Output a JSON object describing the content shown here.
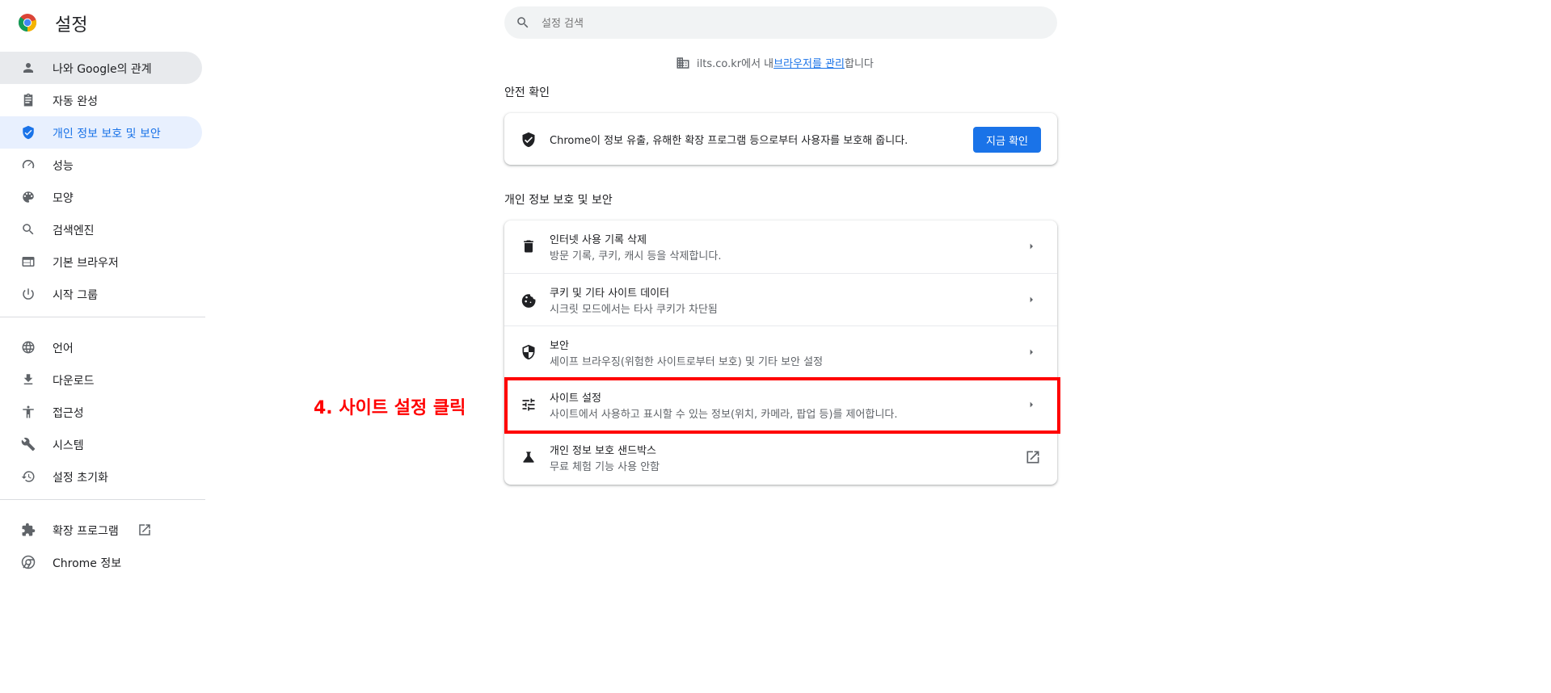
{
  "app": {
    "title": "설정"
  },
  "search": {
    "placeholder": "설정 검색"
  },
  "managed": {
    "prefix": "ilts.co.kr에서 내 ",
    "link": "브라우저를 관리",
    "suffix": "합니다"
  },
  "sidebar": {
    "items": [
      {
        "label": "나와 Google의 관계",
        "icon": "person-icon",
        "state": "hover"
      },
      {
        "label": "자동 완성",
        "icon": "clipboard-icon"
      },
      {
        "label": "개인 정보 보호 및 보안",
        "icon": "shield-icon",
        "state": "active"
      },
      {
        "label": "성능",
        "icon": "speedometer-icon"
      },
      {
        "label": "모양",
        "icon": "palette-icon"
      },
      {
        "label": "검색엔진",
        "icon": "search-icon"
      },
      {
        "label": "기본 브라우저",
        "icon": "browser-icon"
      },
      {
        "label": "시작 그룹",
        "icon": "power-icon"
      }
    ],
    "items2": [
      {
        "label": "언어",
        "icon": "globe-icon"
      },
      {
        "label": "다운로드",
        "icon": "download-icon"
      },
      {
        "label": "접근성",
        "icon": "accessibility-icon"
      },
      {
        "label": "시스템",
        "icon": "wrench-icon"
      },
      {
        "label": "설정 초기화",
        "icon": "history-icon"
      }
    ],
    "items3": [
      {
        "label": "확장 프로그램",
        "icon": "puzzle-icon"
      },
      {
        "label": "Chrome 정보",
        "icon": "chrome-icon"
      }
    ]
  },
  "safety": {
    "section_title": "안전 확인",
    "text": "Chrome이 정보 유출, 유해한 확장 프로그램 등으로부터 사용자를 보호해 줍니다.",
    "button": "지금 확인"
  },
  "privacy": {
    "section_title": "개인 정보 보호 및 보안",
    "rows": [
      {
        "title": "인터넷 사용 기록 삭제",
        "subtitle": "방문 기록, 쿠키, 캐시 등을 삭제합니다.",
        "icon": "trash-icon"
      },
      {
        "title": "쿠키 및 기타 사이트 데이터",
        "subtitle": "시크릿 모드에서는 타사 쿠키가 차단됨",
        "icon": "cookie-icon"
      },
      {
        "title": "보안",
        "subtitle": "세이프 브라우징(위험한 사이트로부터 보호) 및 기타 보안 설정",
        "icon": "shield-icon"
      },
      {
        "title": "사이트 설정",
        "subtitle": "사이트에서 사용하고 표시할 수 있는 정보(위치, 카메라, 팝업 등)를 제어합니다.",
        "icon": "tune-icon"
      },
      {
        "title": "개인 정보 보호 샌드박스",
        "subtitle": "무료 체험 기능 사용 안함",
        "icon": "flask-icon"
      }
    ]
  },
  "annotation": {
    "text": "4. 사이트 설정 클릭",
    "color": "#ff0000"
  },
  "colors": {
    "accent": "#1a73e8",
    "active_bg": "#e8f0fe",
    "hover_bg": "#e8eaed"
  }
}
